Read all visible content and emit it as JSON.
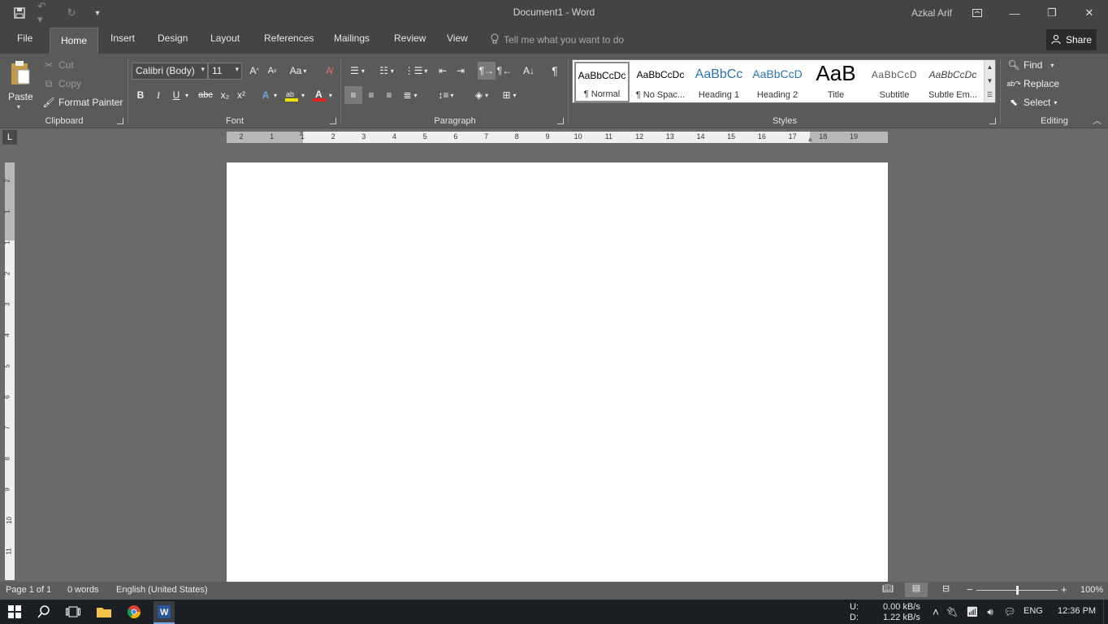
{
  "window": {
    "title": "Document1 - Word",
    "user": "Azkal Arif"
  },
  "tabs": [
    "File",
    "Home",
    "Insert",
    "Design",
    "Layout",
    "References",
    "Mailings",
    "Review",
    "View"
  ],
  "active_tab": "Home",
  "tell_me": {
    "placeholder": "Tell me what you want to do"
  },
  "share_label": "Share",
  "clipboard": {
    "label": "Clipboard",
    "paste": "Paste",
    "cut": "Cut",
    "copy": "Copy",
    "format_painter": "Format Painter"
  },
  "font": {
    "label": "Font",
    "family": "Calibri (Body)",
    "size": "11",
    "bold": "B",
    "italic": "I",
    "underline": "U",
    "strike": "abc",
    "subscript": "x₂",
    "superscript": "x²",
    "change_case": "Aa",
    "highlight_color": "#f2e000",
    "font_color": "#e21d1d"
  },
  "paragraph": {
    "label": "Paragraph"
  },
  "styles": {
    "label": "Styles",
    "items": [
      {
        "preview": "AaBbCcDc",
        "name": "¶ Normal",
        "color": "#000000"
      },
      {
        "preview": "AaBbCcDc",
        "name": "¶ No Spac...",
        "color": "#000000"
      },
      {
        "preview": "AaBbCc",
        "name": "Heading 1",
        "color": "#2e74b5"
      },
      {
        "preview": "AaBbCcD",
        "name": "Heading 2",
        "color": "#2e74b5"
      },
      {
        "preview": "AaB",
        "name": "Title",
        "color": "#000000"
      },
      {
        "preview": "AaBbCcD",
        "name": "Subtitle",
        "color": "#5a5a5a"
      },
      {
        "preview": "AaBbCcDc",
        "name": "Subtle Em...",
        "color": "#404040"
      }
    ]
  },
  "editing": {
    "label": "Editing",
    "find": "Find",
    "replace": "Replace",
    "select": "Select"
  },
  "ruler": {
    "h_numbers": [
      "2",
      "1",
      "1",
      "2",
      "3",
      "4",
      "5",
      "6",
      "7",
      "8",
      "9",
      "10",
      "11",
      "12",
      "13",
      "14",
      "15",
      "16",
      "17",
      "18",
      "19"
    ],
    "v_numbers": [
      "2",
      "1",
      "1",
      "2",
      "3",
      "4",
      "5",
      "6",
      "7",
      "8",
      "9",
      "10",
      "11"
    ]
  },
  "status": {
    "page": "Page 1 of 1",
    "words": "0 words",
    "language": "English (United States)",
    "zoom": "100%"
  },
  "taskbar": {
    "net_up_label": "U:",
    "net_up": "0.00 kB/s",
    "net_down_label": "D:",
    "net_down": "1.22 kB/s",
    "lang": "ENG",
    "time": "12:36 PM"
  }
}
